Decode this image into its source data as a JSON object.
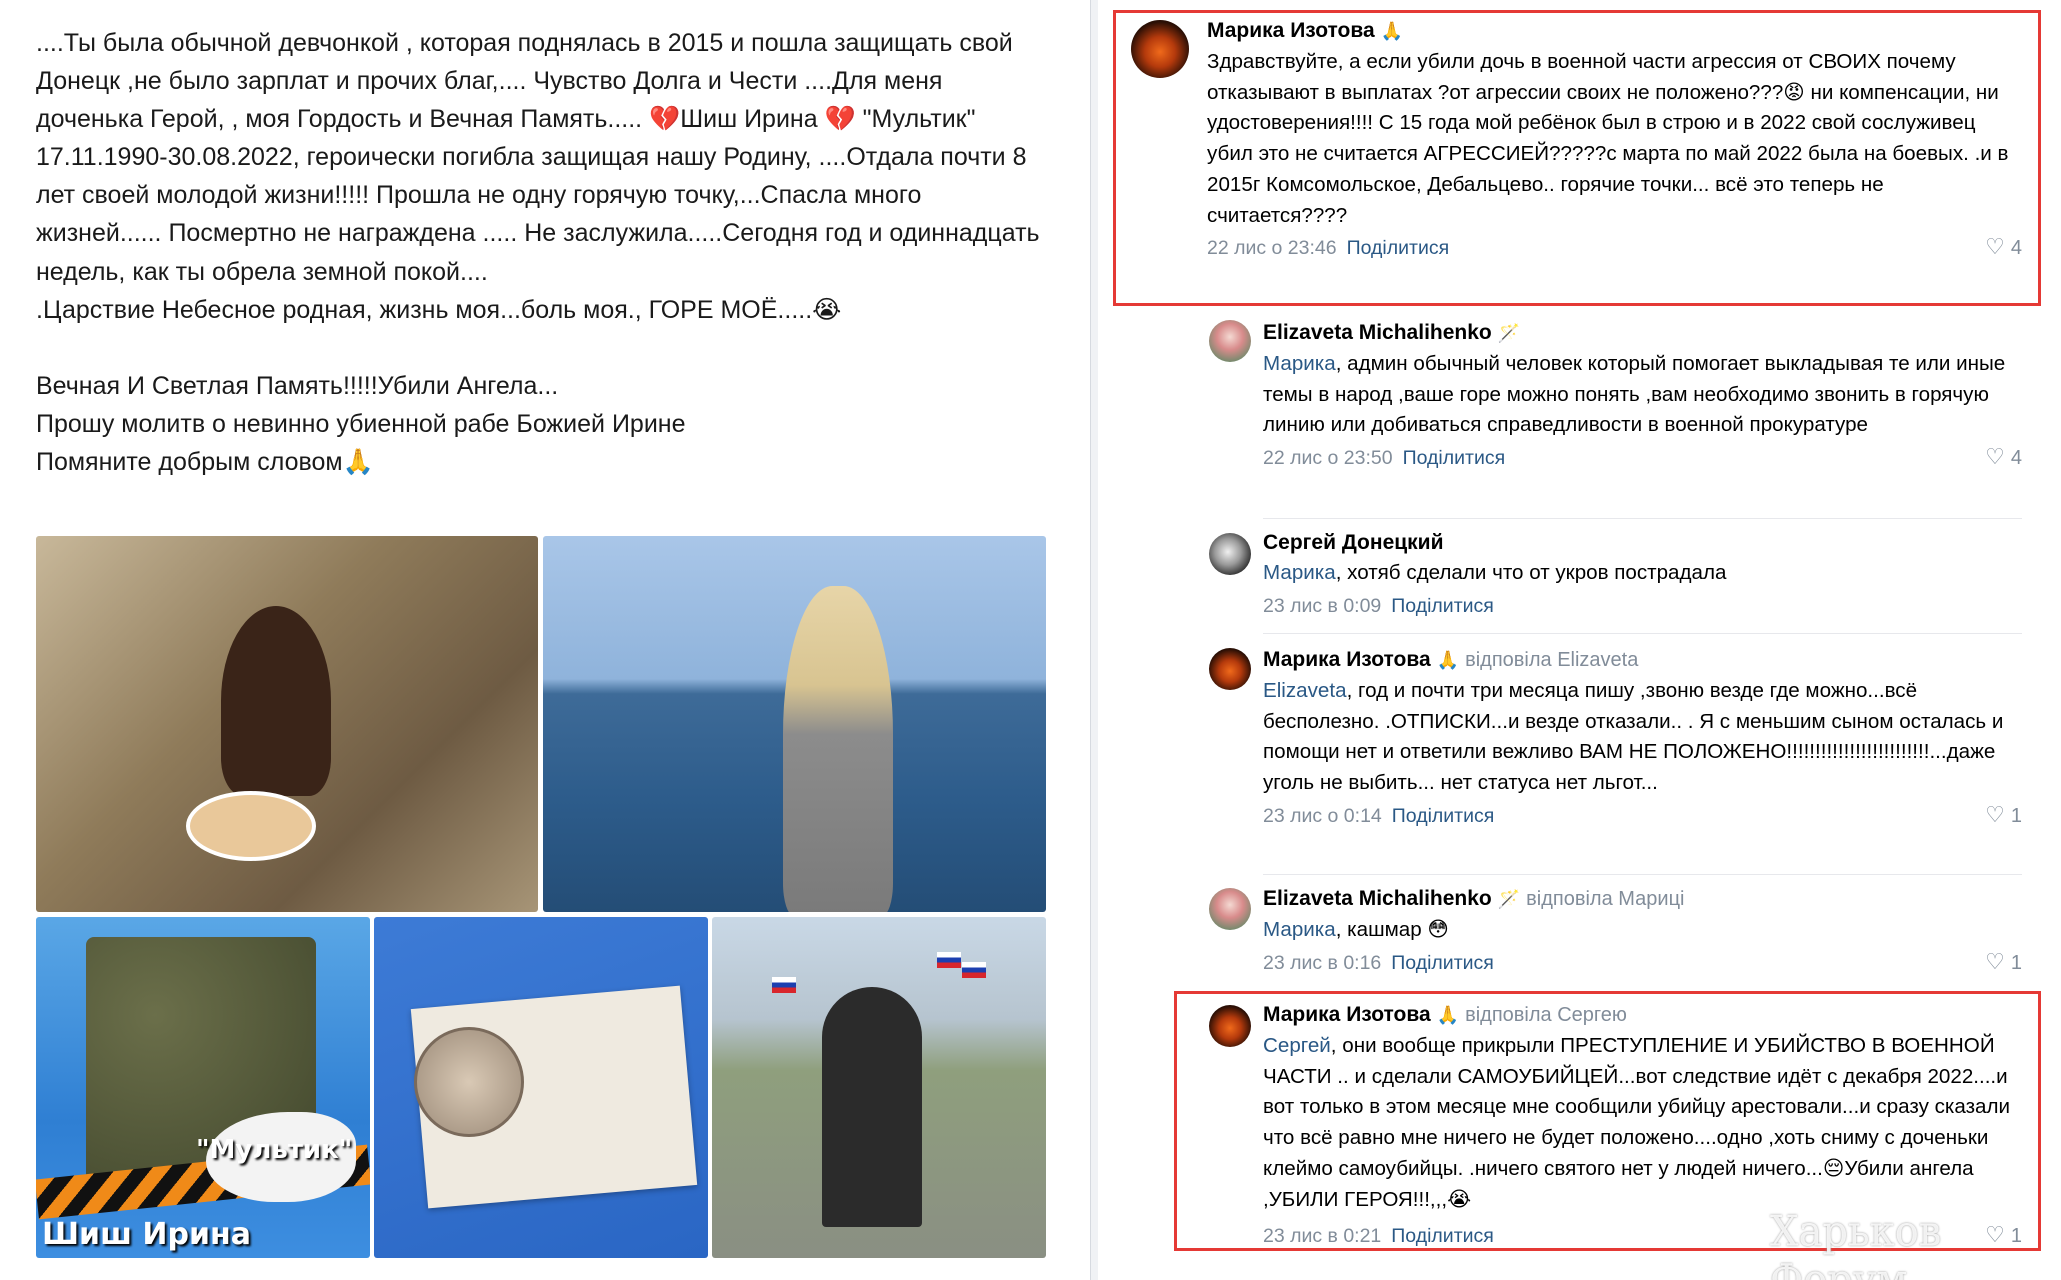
{
  "post": {
    "text": "....Ты была обычной девчонкой , которая поднялась в 2015 и пошла защищать свой Донецк ,не было зарплат и прочих благ,.... Чувство Долга и Чести ....Для меня доченька Герой, , моя Гордость и Вечная Память..... 💔Шиш Ирина 💔 \"Мультик\" 17.11.1990-30.08.2022, героически погибла защищая нашу Родину, ....Отдала почти 8 лет своей молодой жизни!!!!! Прошла не одну горячую точку,...Спасла много жизней...... Посмертно не награждена ..... Не заслужила.....Сегодня год и одиннадцать недель, как ты обрела земной покой....\n.Царствие Небесное родная, жизнь моя...боль моя., ГОРЕ МОЁ.....😭\n\nВечная И Светлая Память!!!!!Убили Ангела...\nПрошу молитв о невинно убиенной рабе Божией Ирине\nПомяните добрым словом🙏",
    "photo_captions": {
      "p3_nickname": "\"Мультик\"",
      "p3_name": "Шиш Ирина"
    }
  },
  "comments": [
    {
      "author": "Марика Изотова",
      "emoji": "🙏",
      "reply_to": "",
      "mention": "",
      "text": "Здравствуйте, а если убили дочь в военной части агрессия от СВОИХ почему отказывают в выплатах ?от агрессии своих не положено???😡 ни компенсации, ни удостоверения!!!! С 15 года мой ребёнок был в строю и в 2022 свой сослуживец убил это не считается АГРЕССИЕЙ?????с марта по май 2022 была на боевых. .и в 2015г Комсомольское, Дебальцево.. горячие точки... всё это теперь не считается????",
      "time": "22 лис о 23:46",
      "share": "Поділитися",
      "likes": "4"
    },
    {
      "author": "Elizaveta Michalihenko",
      "emoji": "🪄",
      "reply_to": "",
      "mention": "Марика",
      "text": ", админ обычный человек который помогает выкладывая те или иные темы в народ ,ваше горе можно понять ,вам необходимо звонить в горячую линию или добиваться справедливости в военной прокуратуре",
      "time": "22 лис о 23:50",
      "share": "Поділитися",
      "likes": "4"
    },
    {
      "author": "Сергей Донецкий",
      "emoji": "",
      "reply_to": "",
      "mention": "Марика",
      "text": ", хотяб сделали что от укров пострадала",
      "time": "23 лис в 0:09",
      "share": "Поділитися",
      "likes": ""
    },
    {
      "author": "Марика Изотова",
      "emoji": "🙏",
      "reply_to": "відповіла Elizaveta",
      "mention": "Elizaveta",
      "text": ", год и почти три месяца пишу ,звоню везде где можно...всё бесполезно. .ОТПИСКИ...и везде отказали.. . Я с меньшим сыном осталась и помощи нет и ответили вежливо ВАМ НЕ ПОЛОЖЕНО!!!!!!!!!!!!!!!!!!!!!!!!!...даже уголь не выбить... нет статуса нет льгот...",
      "time": "23 лис о 0:14",
      "share": "Поділитися",
      "likes": "1"
    },
    {
      "author": "Elizaveta Michalihenko",
      "emoji": "🪄",
      "reply_to": "відповіла Мариці",
      "mention": "Марика",
      "text": ", кашмар 😳",
      "time": "23 лис в 0:16",
      "share": "Поділитися",
      "likes": "1"
    },
    {
      "author": "Марика Изотова",
      "emoji": "🙏",
      "reply_to": "відповіла Сергею",
      "mention": "Сергей",
      "text": ", они вообще прикрыли ПРЕСТУПЛЕНИЕ И УБИЙСТВО В ВОЕННОЙ ЧАСТИ .. и сделали САМОУБИЙЦЕЙ...вот следствие идёт с декабря 2022....и вот только в этом месяце мне сообщили убийцу арестовали...и сразу сказали что всё равно мне ничего не будет положено....одно ,хоть сниму с доченьки клеймо самоубийцы. .ничего святого нет у людей ничего...😔Убили ангела ,УБИЛИ ГЕРОЯ!!!,,,😭",
      "time": "23 лис в 0:21",
      "share": "Поділитися",
      "likes": "1"
    }
  ],
  "icons": {
    "heart": "heart-outline-icon"
  },
  "colors": {
    "link": "#2a5885",
    "meta": "#818c99",
    "highlight_border": "#e53935"
  },
  "watermark": "Харьков Форум"
}
